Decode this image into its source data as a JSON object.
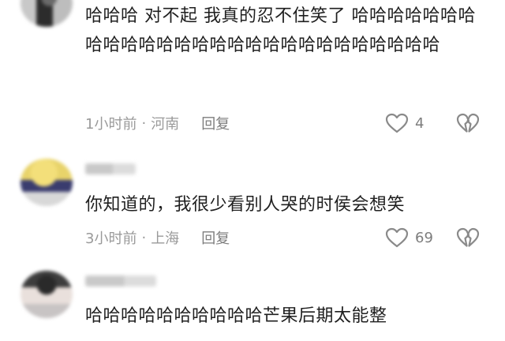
{
  "comments": [
    {
      "text": "哈哈哈 对不起 我真的忍不住笑了 哈哈哈哈哈哈哈哈哈哈哈哈哈哈哈哈哈哈哈哈哈哈哈哈哈哈哈",
      "time": "1小时前",
      "location": "河南",
      "reply": "回复",
      "likes": "4"
    },
    {
      "text": "你知道的，我很少看别人哭的时侯会想笑",
      "time": "3小时前",
      "location": "上海",
      "reply": "回复",
      "likes": "69"
    },
    {
      "text": "哈哈哈哈哈哈哈哈哈哈芒果后期太能整"
    }
  ],
  "separator": "·",
  "icons": {
    "like": "heart-outline-icon",
    "dislike": "broken-heart-icon"
  },
  "colors": {
    "meta": "#9a9a9a",
    "text": "#1f1f1f"
  }
}
